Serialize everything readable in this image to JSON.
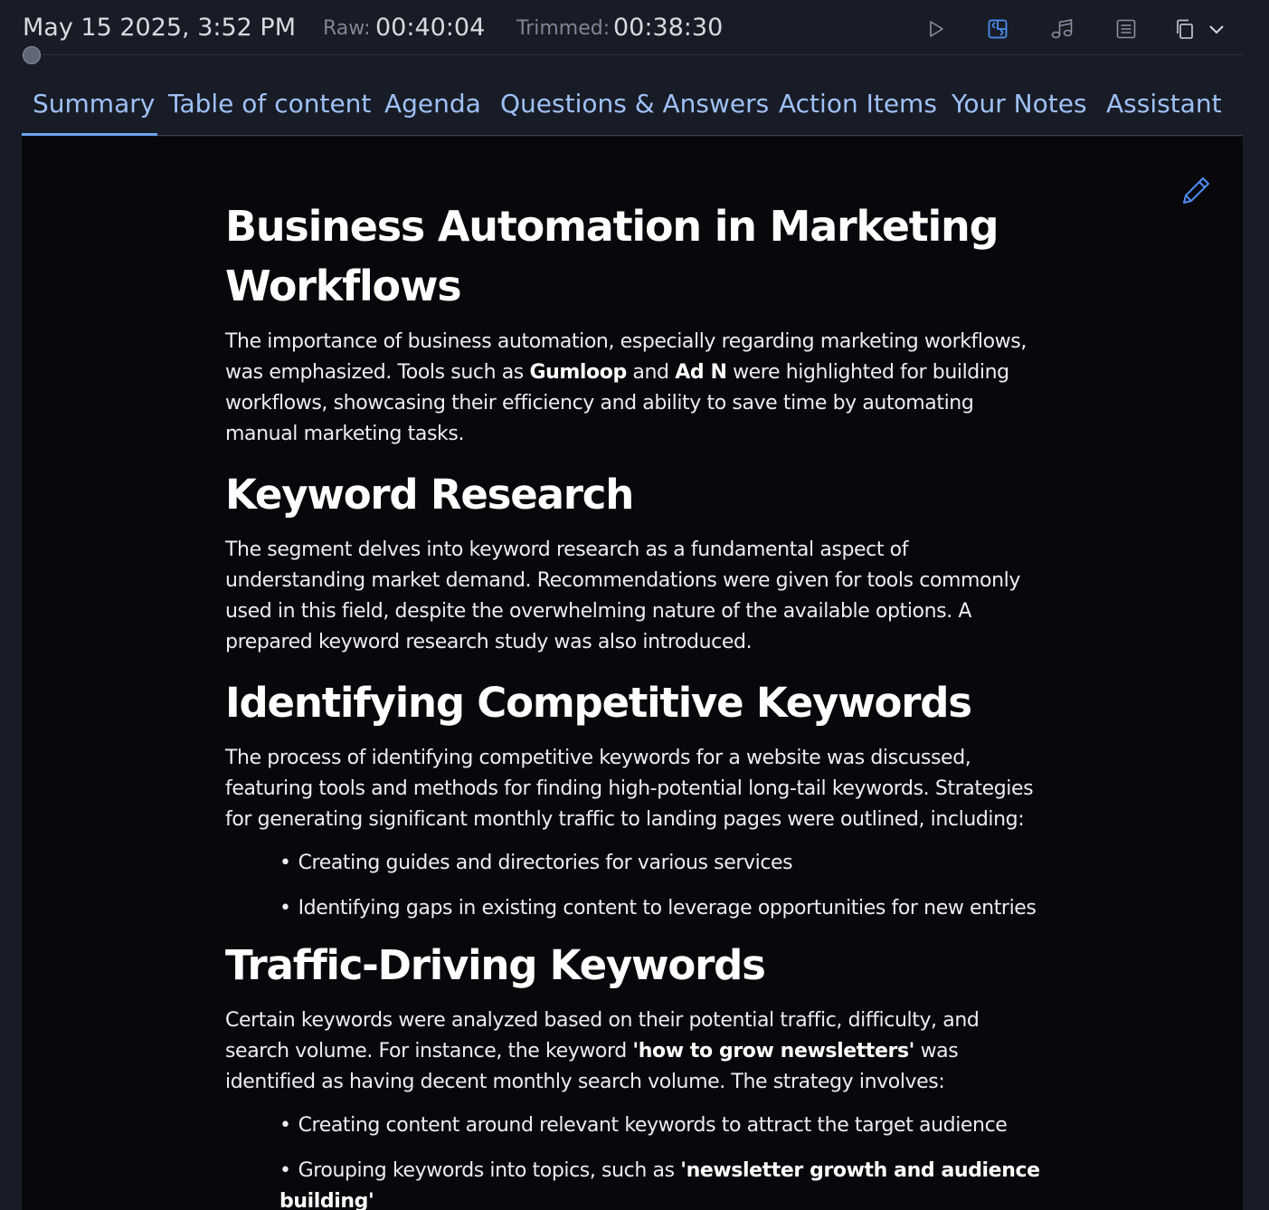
{
  "header": {
    "datetime": "May 15 2025, 3:52 PM",
    "raw_label": "Raw:",
    "raw_value": "00:40:04",
    "trimmed_label": "Trimmed:",
    "trimmed_value": "00:38:30",
    "tools": [
      "play-icon",
      "layout-icon",
      "music-note-icon",
      "document-icon",
      "copy-icon",
      "chevron-down-icon"
    ],
    "active_tool": "layout-icon",
    "accent_color": "#4c8ef0"
  },
  "tabs": [
    {
      "label": "Summary",
      "active": true
    },
    {
      "label": "Table of content"
    },
    {
      "label": "Agenda"
    },
    {
      "label": "Questions & Answers"
    },
    {
      "label": "Action Items"
    },
    {
      "label": "Your Notes"
    },
    {
      "label": "Assistant"
    }
  ],
  "doc": {
    "title": "Business Automation in Marketing Workflows",
    "intro": {
      "t1": "The importance of business automation, especially regarding marketing workflows, was emphasized. Tools such as ",
      "b1": "Gumloop",
      "t2": " and ",
      "b2": "Ad N",
      "t3": " were highlighted for building workflows, showcasing their efficiency and ability to save time by automating manual marketing tasks."
    },
    "s1": {
      "heading": "Keyword Research",
      "text": "The segment delves into keyword research as a fundamental aspect of understanding market demand. Recommendations were given for tools commonly used in this field, despite the overwhelming nature of the available options. A prepared keyword research study was also introduced."
    },
    "s2": {
      "heading": "Identifying Competitive Keywords",
      "text": "The process of identifying competitive keywords for a website was discussed, featuring tools and methods for finding high-potential long-tail keywords. Strategies for generating significant monthly traffic to landing pages were outlined, including:",
      "bullets": [
        "Creating guides and directories for various services",
        "Identifying gaps in existing content to leverage opportunities for new entries"
      ]
    },
    "s3": {
      "heading": "Traffic-Driving Keywords",
      "t1": "Certain keywords were analyzed based on their potential traffic, difficulty, and search volume. For instance, the keyword ",
      "b1": "'how to grow newsletters'",
      "t2": " was identified as having decent monthly search volume. The strategy involves:",
      "bullet1": "Creating content around relevant keywords to attract the target audience",
      "bullet2_prefix": "Grouping keywords into topics, such as ",
      "bullet2_bold": "'newsletter growth and audience building'"
    }
  }
}
